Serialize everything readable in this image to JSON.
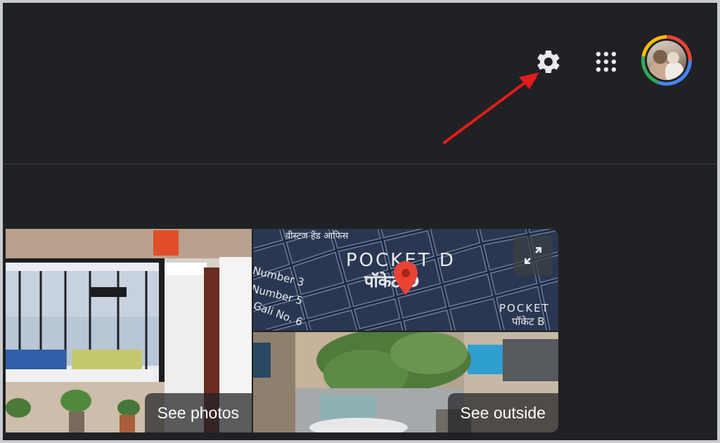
{
  "header": {
    "settings_icon": "gear-icon",
    "apps_icon": "apps-grid-icon",
    "avatar_icon": "profile-avatar"
  },
  "annotation": {
    "arrow_color": "#e31b1b"
  },
  "gallery": {
    "photos_label": "See photos",
    "outside_label": "See outside",
    "map": {
      "area_label_en": "POCKET D",
      "area_label_hi": "पॉकेट D",
      "top_label": "वीस्टज हेड आफिस",
      "street_1": "Number 3",
      "street_2": "Number 5",
      "street_3": "Gali No. 6",
      "corner_label_en": "POCKET",
      "corner_label_hi": "पॉकेट B",
      "expand_icon": "expand-icon",
      "pin_icon": "map-pin-icon",
      "pin_color": "#ea4335"
    }
  },
  "colors": {
    "background": "#202124",
    "divider": "#3c4043",
    "icon": "#e8eaed"
  }
}
